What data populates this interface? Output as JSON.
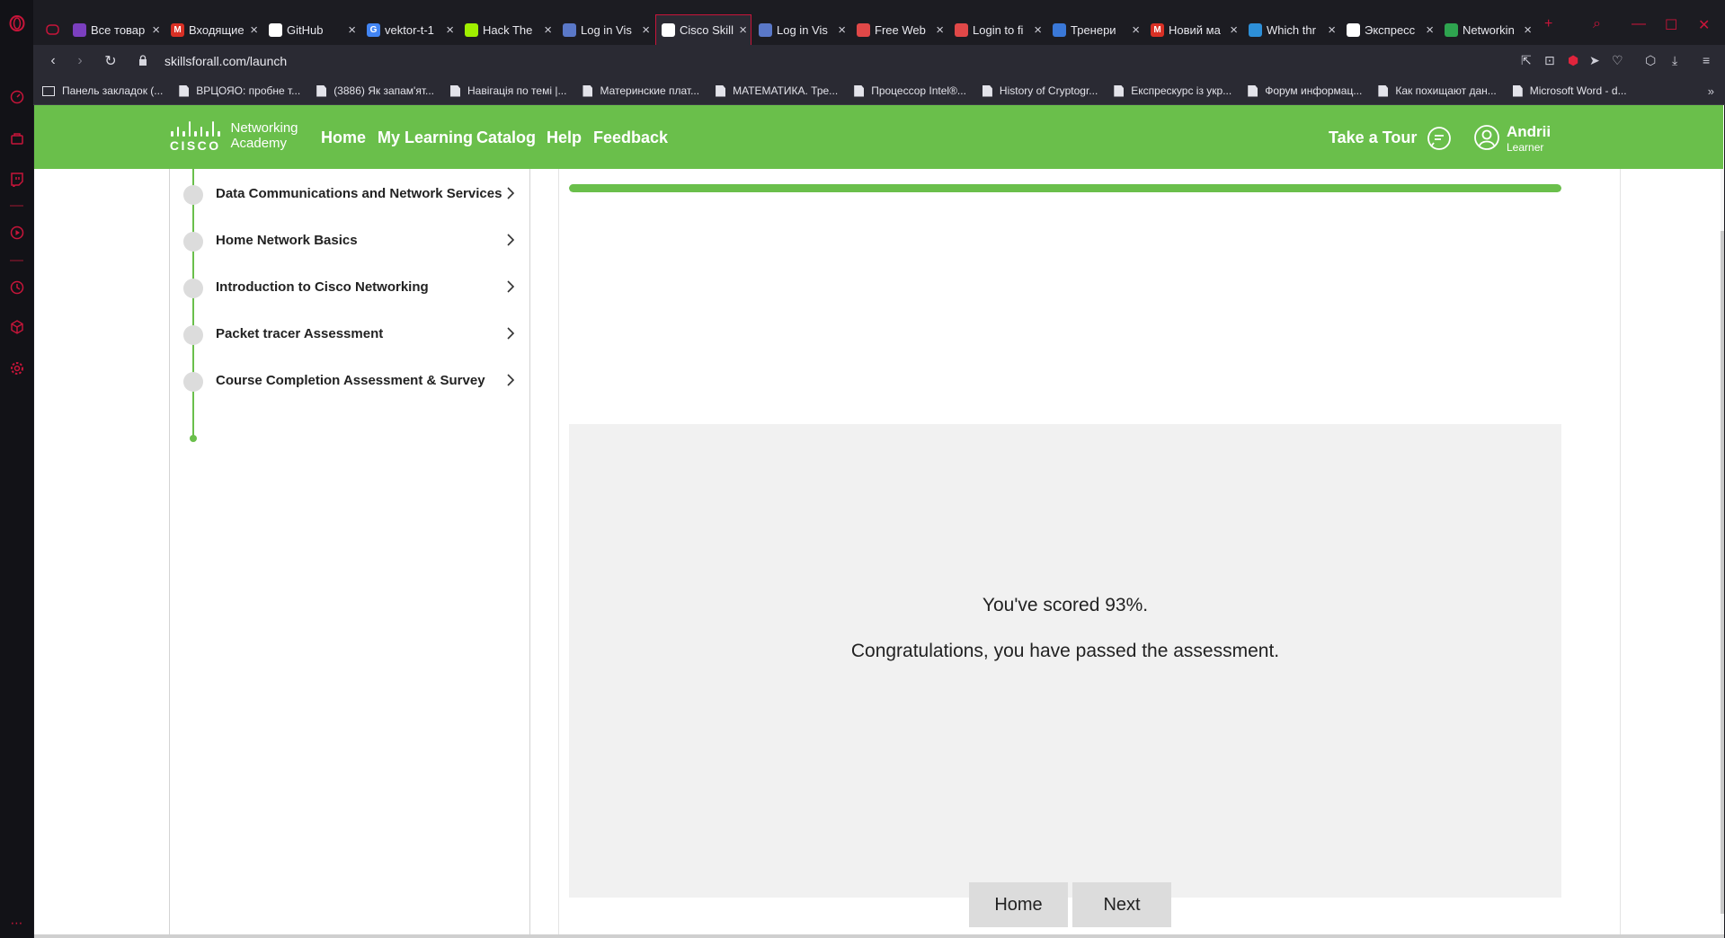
{
  "browser": {
    "url": "skillsforall.com/launch",
    "tabs": [
      {
        "title": "Все товар",
        "color": "#7b3fbf",
        "glyph": ""
      },
      {
        "title": "Входящие",
        "color": "#d93025",
        "glyph": "M"
      },
      {
        "title": "GitHub",
        "color": "#ffffff",
        "glyph": ""
      },
      {
        "title": "vektor-t-1",
        "color": "#4285f4",
        "glyph": "G"
      },
      {
        "title": "Hack The ",
        "color": "#9fef00",
        "glyph": ""
      },
      {
        "title": "Log in Vis",
        "color": "#5a78c8",
        "glyph": ""
      },
      {
        "title": "Cisco Skill",
        "color": "#ffffff",
        "glyph": ""
      },
      {
        "title": "Log in Vis",
        "color": "#5a78c8",
        "glyph": ""
      },
      {
        "title": "Free Web",
        "color": "#e04848",
        "glyph": ""
      },
      {
        "title": "Login to fi",
        "color": "#e04848",
        "glyph": ""
      },
      {
        "title": "Тренери ",
        "color": "#3a78d8",
        "glyph": ""
      },
      {
        "title": "Новий ма",
        "color": "#d93025",
        "glyph": "M"
      },
      {
        "title": "Which thr",
        "color": "#2d8fd8",
        "glyph": ""
      },
      {
        "title": "Экспресс",
        "color": "#ffffff",
        "glyph": ""
      },
      {
        "title": "Networkin",
        "color": "#2ea44f",
        "glyph": ""
      }
    ],
    "bookmarks": [
      "Панель закладок (...",
      "ВРЦОЯО: пробне т...",
      "(3886) Як запам'ят...",
      "Навігація по темі |...",
      "Материнские плат...",
      "МАТЕМАТИКА. Тре...",
      "Процессор Intel®...",
      "History of Cryptogr...",
      "Експрескурс із укр...",
      "Форум информац...",
      "Как похищают дан...",
      "Microsoft Word - d..."
    ]
  },
  "site": {
    "logo_brand": "CISCO",
    "logo_line1": "Networking",
    "logo_line2": "Academy",
    "nav": [
      "Home",
      "My Learning",
      "Catalog",
      "Help",
      "Feedback"
    ],
    "take_tour": "Take a Tour",
    "user_name": "Andrii",
    "user_role": "Learner",
    "accent": "#6abf4b"
  },
  "course": {
    "modules": [
      "Data Communications and Network Services",
      "Home Network Basics",
      "Introduction to Cisco Networking",
      "Packet tracer Assessment",
      "Course Completion Assessment & Survey"
    ]
  },
  "assessment": {
    "progress_percent": 100,
    "score_text": "You've scored 93%.",
    "message": "Congratulations, you have passed the assessment.",
    "home_button": "Home",
    "next_button": "Next"
  }
}
